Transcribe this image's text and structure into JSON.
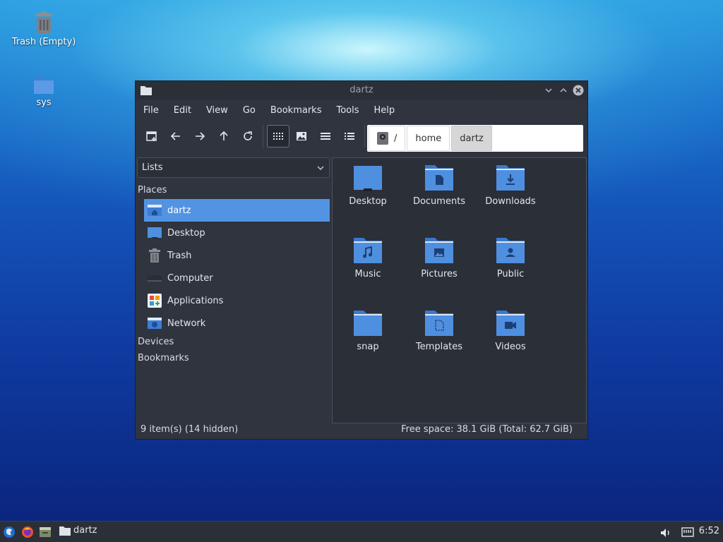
{
  "desktop": {
    "icons": [
      {
        "label": "Trash (Empty)",
        "icon": "trash-icon"
      },
      {
        "label": "sys",
        "icon": "folder-icon"
      }
    ]
  },
  "window": {
    "title": "dartz",
    "menu": [
      "File",
      "Edit",
      "View",
      "Go",
      "Bookmarks",
      "Tools",
      "Help"
    ],
    "toolbar": {
      "buttons": [
        "new-tab-icon",
        "back-arrow-icon",
        "forward-arrow-icon",
        "up-arrow-icon",
        "reload-icon",
        "icon-view-icon",
        "thumbnail-view-icon",
        "compact-view-icon",
        "detailed-list-view-icon"
      ],
      "active_view": "icon-view"
    },
    "path": {
      "crumbs": [
        "/",
        "home",
        "dartz"
      ]
    },
    "sidebar": {
      "select_value": "Lists",
      "sections": {
        "places": "Places",
        "devices": "Devices",
        "bookmarks": "Bookmarks"
      },
      "places": [
        {
          "label": "dartz",
          "icon": "home-folder-icon",
          "selected": true
        },
        {
          "label": "Desktop",
          "icon": "desktop-icon"
        },
        {
          "label": "Trash",
          "icon": "trash-icon"
        },
        {
          "label": "Computer",
          "icon": "computer-icon"
        },
        {
          "label": "Applications",
          "icon": "applications-icon"
        },
        {
          "label": "Network",
          "icon": "network-icon"
        }
      ]
    },
    "files": [
      {
        "name": "Desktop",
        "icon": "desktop-folder-icon"
      },
      {
        "name": "Documents",
        "icon": "documents-folder-icon"
      },
      {
        "name": "Downloads",
        "icon": "downloads-folder-icon"
      },
      {
        "name": "Music",
        "icon": "music-folder-icon"
      },
      {
        "name": "Pictures",
        "icon": "pictures-folder-icon"
      },
      {
        "name": "Public",
        "icon": "public-folder-icon"
      },
      {
        "name": "snap",
        "icon": "folder-icon"
      },
      {
        "name": "Templates",
        "icon": "templates-folder-icon"
      },
      {
        "name": "Videos",
        "icon": "videos-folder-icon"
      }
    ],
    "status": {
      "items": "9 item(s) (14 hidden)",
      "free_space": "Free space: 38.1 GiB (Total: 62.7 GiB)"
    }
  },
  "taskbar": {
    "window_button": "dartz",
    "clock": "6:52"
  },
  "colors": {
    "accent": "#5294e2",
    "window_bg": "#2f343f",
    "folder_blue": "#4f8fe0"
  }
}
